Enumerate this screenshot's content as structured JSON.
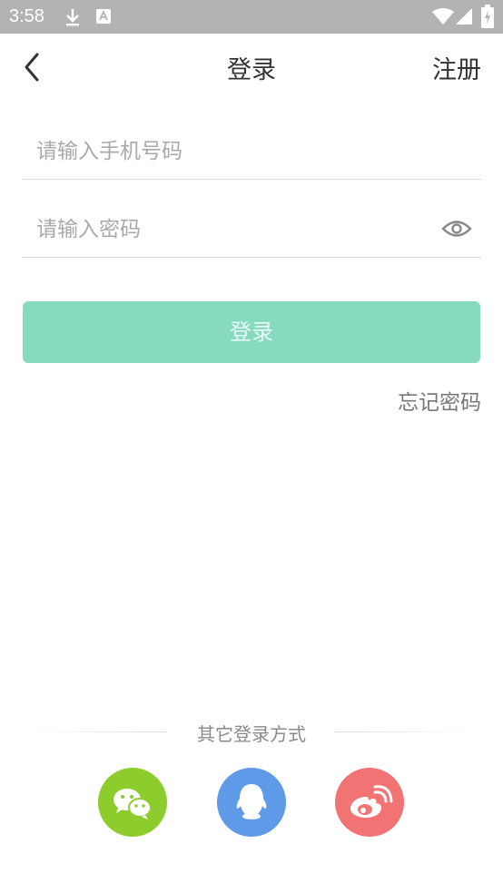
{
  "status_bar": {
    "time": "3:58",
    "icons": [
      "download-icon",
      "keyboard-a-icon",
      "wifi-icon",
      "signal-icon",
      "battery-charging-icon"
    ]
  },
  "header": {
    "title": "登录",
    "register_label": "注册",
    "back_icon": "chevron-left-icon"
  },
  "form": {
    "phone_placeholder": "请输入手机号码",
    "phone_value": "",
    "password_placeholder": "请输入密码",
    "password_value": "",
    "eye_icon": "eye-icon",
    "login_label": "登录",
    "forgot_label": "忘记密码"
  },
  "other_login": {
    "title": "其它登录方式",
    "providers": [
      {
        "name": "wechat",
        "icon": "wechat-icon",
        "color": "#8ccc2d"
      },
      {
        "name": "qq",
        "icon": "qq-icon",
        "color": "#5f9ae8"
      },
      {
        "name": "weibo",
        "icon": "weibo-icon",
        "color": "#f17373"
      }
    ]
  },
  "colors": {
    "status_bar": "#b3b3b3",
    "login_button": "#7fd9bc",
    "text_primary": "#333333",
    "placeholder": "#a9a9a9"
  }
}
